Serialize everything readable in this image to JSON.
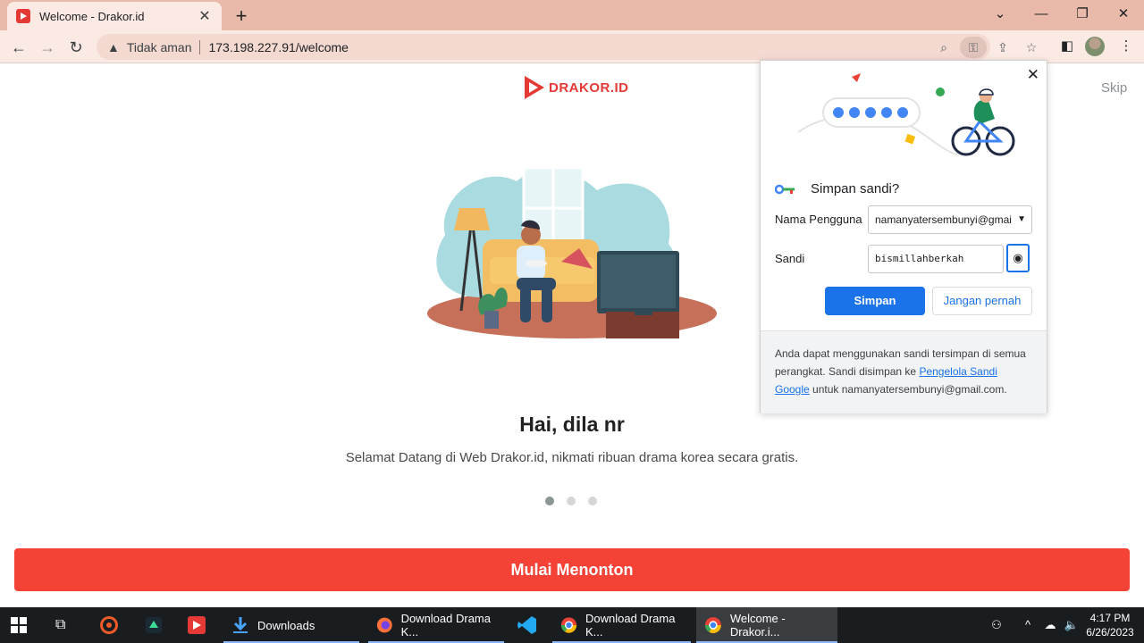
{
  "browser": {
    "tab_title": "Welcome - Drakor.id",
    "security_label": "Tidak aman",
    "url": "173.198.227.91/welcome"
  },
  "page": {
    "logo_text": "DRAKOR.ID",
    "skip": "Skip",
    "headline": "Hai, dila nr",
    "subline": "Selamat Datang di Web Drakor.id, nikmati ribuan drama korea secara gratis.",
    "cta": "Mulai Menonton",
    "dots_active_index": 0
  },
  "popup": {
    "title": "Simpan sandi?",
    "username_label": "Nama Pengguna",
    "username_value": "namanyatersembunyi@gmai",
    "password_label": "Sandi",
    "password_value": "bismillahberkah",
    "save_button": "Simpan",
    "never_button": "Jangan pernah",
    "footer_text_1": "Anda dapat menggunakan sandi tersimpan di semua perangkat. Sandi disimpan ke",
    "footer_link": "Pengelola Sandi Google",
    "footer_text_2": "untuk namanyatersembunyi@gmail.com."
  },
  "taskbar": {
    "items": [
      "Downloads",
      "Download Drama K...",
      "Download Drama K...",
      "Welcome - Drakor.i..."
    ],
    "time": "4:17 PM",
    "date": "6/26/2023"
  },
  "colors": {
    "accent_red": "#f44336",
    "chrome_blue": "#1a73e8",
    "tabbar": "#e9b9a9"
  }
}
